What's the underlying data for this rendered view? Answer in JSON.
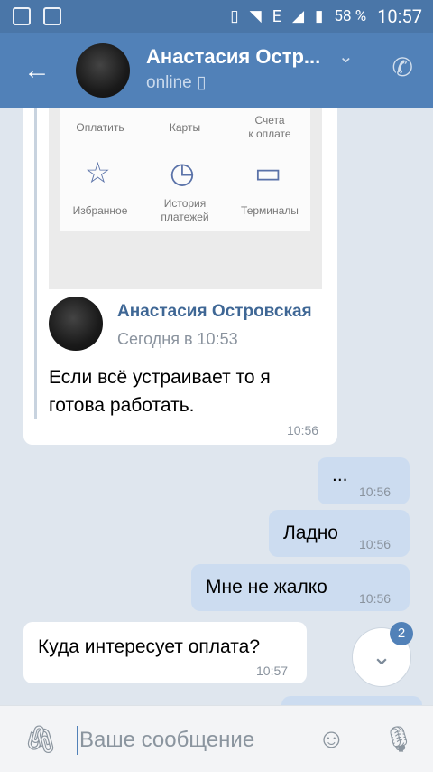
{
  "status_bar": {
    "battery": "58 %",
    "time": "10:57",
    "network_type": "E"
  },
  "header": {
    "contact_name": "Анастасия Остр...",
    "status": "online"
  },
  "forwarded_message": {
    "screenshot_items": [
      {
        "label": "Оплатить"
      },
      {
        "label": "Карты"
      },
      {
        "label": "Счета\nк оплате"
      },
      {
        "label": "Избранное",
        "icon": "star-icon"
      },
      {
        "label": "История\nплатежей",
        "icon": "clock-icon"
      },
      {
        "label": "Терминалы",
        "icon": "terminal-icon"
      }
    ],
    "author": "Анастасия Островская",
    "date": "Сегодня в 10:53",
    "text": "Если всё устраивает то я готова работать.",
    "time": "10:56"
  },
  "messages": [
    {
      "direction": "out",
      "text": "...",
      "time": "10:56"
    },
    {
      "direction": "out",
      "text": "Ладно",
      "time": "10:56"
    },
    {
      "direction": "out",
      "text": "Мне не жалко",
      "time": "10:56"
    },
    {
      "direction": "in",
      "text": "Куда интересует оплата?",
      "time": "10:57"
    }
  ],
  "scroll_badge": "2",
  "composer": {
    "placeholder": "Ваше сообщение"
  },
  "colors": {
    "header": "#5181b8",
    "status_bar": "#4a76a8",
    "outgoing_bubble": "#ccdcf0",
    "incoming_bubble": "#ffffff",
    "chat_background": "#dfe6ee"
  }
}
